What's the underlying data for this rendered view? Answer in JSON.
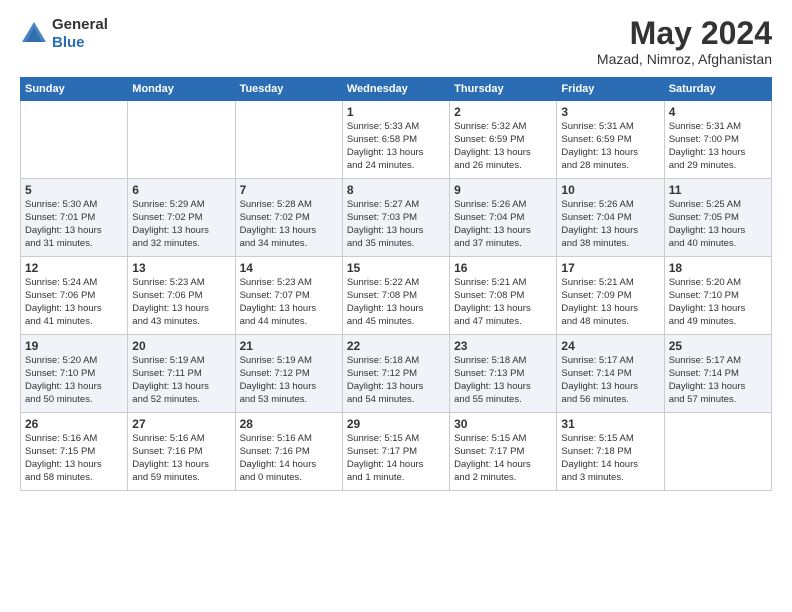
{
  "header": {
    "logo_general": "General",
    "logo_blue": "Blue",
    "title": "May 2024",
    "location": "Mazad, Nimroz, Afghanistan"
  },
  "days_of_week": [
    "Sunday",
    "Monday",
    "Tuesday",
    "Wednesday",
    "Thursday",
    "Friday",
    "Saturday"
  ],
  "weeks": [
    [
      {
        "day": "",
        "info": ""
      },
      {
        "day": "",
        "info": ""
      },
      {
        "day": "",
        "info": ""
      },
      {
        "day": "1",
        "info": "Sunrise: 5:33 AM\nSunset: 6:58 PM\nDaylight: 13 hours\nand 24 minutes."
      },
      {
        "day": "2",
        "info": "Sunrise: 5:32 AM\nSunset: 6:59 PM\nDaylight: 13 hours\nand 26 minutes."
      },
      {
        "day": "3",
        "info": "Sunrise: 5:31 AM\nSunset: 6:59 PM\nDaylight: 13 hours\nand 28 minutes."
      },
      {
        "day": "4",
        "info": "Sunrise: 5:31 AM\nSunset: 7:00 PM\nDaylight: 13 hours\nand 29 minutes."
      }
    ],
    [
      {
        "day": "5",
        "info": "Sunrise: 5:30 AM\nSunset: 7:01 PM\nDaylight: 13 hours\nand 31 minutes."
      },
      {
        "day": "6",
        "info": "Sunrise: 5:29 AM\nSunset: 7:02 PM\nDaylight: 13 hours\nand 32 minutes."
      },
      {
        "day": "7",
        "info": "Sunrise: 5:28 AM\nSunset: 7:02 PM\nDaylight: 13 hours\nand 34 minutes."
      },
      {
        "day": "8",
        "info": "Sunrise: 5:27 AM\nSunset: 7:03 PM\nDaylight: 13 hours\nand 35 minutes."
      },
      {
        "day": "9",
        "info": "Sunrise: 5:26 AM\nSunset: 7:04 PM\nDaylight: 13 hours\nand 37 minutes."
      },
      {
        "day": "10",
        "info": "Sunrise: 5:26 AM\nSunset: 7:04 PM\nDaylight: 13 hours\nand 38 minutes."
      },
      {
        "day": "11",
        "info": "Sunrise: 5:25 AM\nSunset: 7:05 PM\nDaylight: 13 hours\nand 40 minutes."
      }
    ],
    [
      {
        "day": "12",
        "info": "Sunrise: 5:24 AM\nSunset: 7:06 PM\nDaylight: 13 hours\nand 41 minutes."
      },
      {
        "day": "13",
        "info": "Sunrise: 5:23 AM\nSunset: 7:06 PM\nDaylight: 13 hours\nand 43 minutes."
      },
      {
        "day": "14",
        "info": "Sunrise: 5:23 AM\nSunset: 7:07 PM\nDaylight: 13 hours\nand 44 minutes."
      },
      {
        "day": "15",
        "info": "Sunrise: 5:22 AM\nSunset: 7:08 PM\nDaylight: 13 hours\nand 45 minutes."
      },
      {
        "day": "16",
        "info": "Sunrise: 5:21 AM\nSunset: 7:08 PM\nDaylight: 13 hours\nand 47 minutes."
      },
      {
        "day": "17",
        "info": "Sunrise: 5:21 AM\nSunset: 7:09 PM\nDaylight: 13 hours\nand 48 minutes."
      },
      {
        "day": "18",
        "info": "Sunrise: 5:20 AM\nSunset: 7:10 PM\nDaylight: 13 hours\nand 49 minutes."
      }
    ],
    [
      {
        "day": "19",
        "info": "Sunrise: 5:20 AM\nSunset: 7:10 PM\nDaylight: 13 hours\nand 50 minutes."
      },
      {
        "day": "20",
        "info": "Sunrise: 5:19 AM\nSunset: 7:11 PM\nDaylight: 13 hours\nand 52 minutes."
      },
      {
        "day": "21",
        "info": "Sunrise: 5:19 AM\nSunset: 7:12 PM\nDaylight: 13 hours\nand 53 minutes."
      },
      {
        "day": "22",
        "info": "Sunrise: 5:18 AM\nSunset: 7:12 PM\nDaylight: 13 hours\nand 54 minutes."
      },
      {
        "day": "23",
        "info": "Sunrise: 5:18 AM\nSunset: 7:13 PM\nDaylight: 13 hours\nand 55 minutes."
      },
      {
        "day": "24",
        "info": "Sunrise: 5:17 AM\nSunset: 7:14 PM\nDaylight: 13 hours\nand 56 minutes."
      },
      {
        "day": "25",
        "info": "Sunrise: 5:17 AM\nSunset: 7:14 PM\nDaylight: 13 hours\nand 57 minutes."
      }
    ],
    [
      {
        "day": "26",
        "info": "Sunrise: 5:16 AM\nSunset: 7:15 PM\nDaylight: 13 hours\nand 58 minutes."
      },
      {
        "day": "27",
        "info": "Sunrise: 5:16 AM\nSunset: 7:16 PM\nDaylight: 13 hours\nand 59 minutes."
      },
      {
        "day": "28",
        "info": "Sunrise: 5:16 AM\nSunset: 7:16 PM\nDaylight: 14 hours\nand 0 minutes."
      },
      {
        "day": "29",
        "info": "Sunrise: 5:15 AM\nSunset: 7:17 PM\nDaylight: 14 hours\nand 1 minute."
      },
      {
        "day": "30",
        "info": "Sunrise: 5:15 AM\nSunset: 7:17 PM\nDaylight: 14 hours\nand 2 minutes."
      },
      {
        "day": "31",
        "info": "Sunrise: 5:15 AM\nSunset: 7:18 PM\nDaylight: 14 hours\nand 3 minutes."
      },
      {
        "day": "",
        "info": ""
      }
    ]
  ]
}
